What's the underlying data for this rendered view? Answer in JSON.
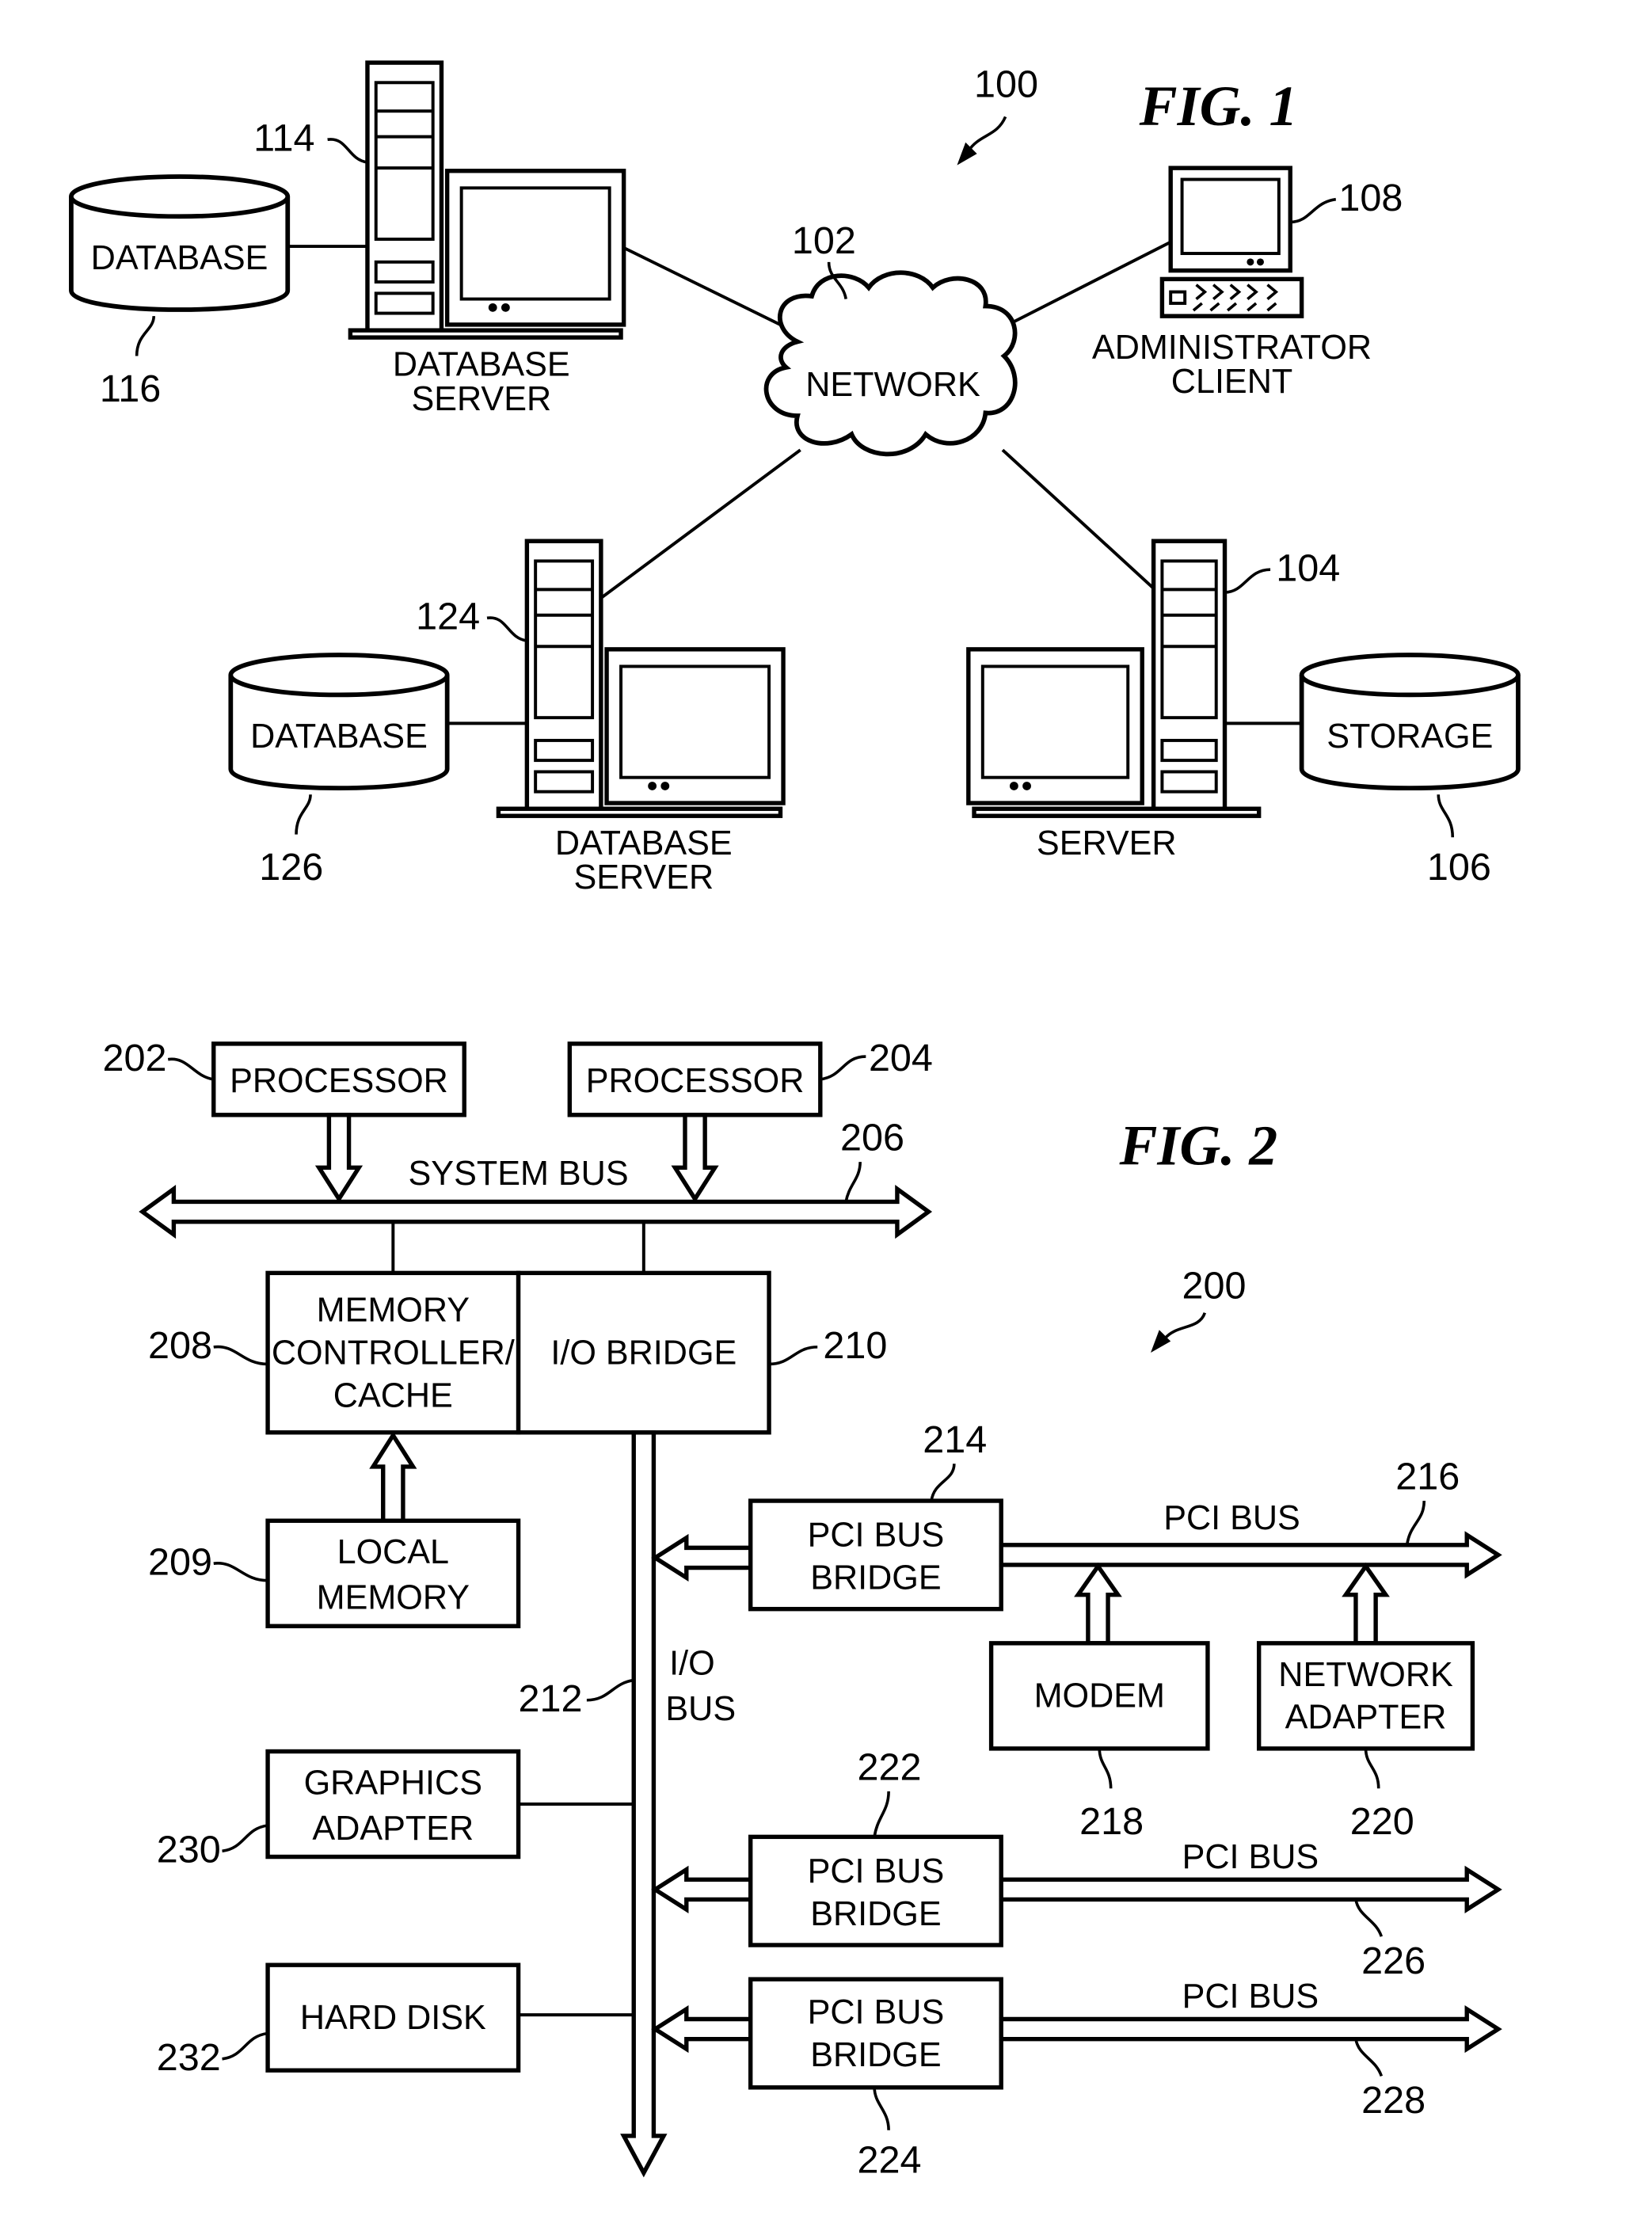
{
  "fig1": {
    "title": "FIG. 1",
    "system_ref": "100",
    "network": {
      "label": "NETWORK",
      "ref": "102"
    },
    "db_server_top": {
      "label_line1": "DATABASE",
      "label_line2": "SERVER",
      "ref": "114"
    },
    "database_top": {
      "label": "DATABASE",
      "ref": "116"
    },
    "admin_client": {
      "label_line1": "ADMINISTRATOR",
      "label_line2": "CLIENT",
      "ref": "108"
    },
    "db_server_bottom": {
      "label_line1": "DATABASE",
      "label_line2": "SERVER",
      "ref": "124"
    },
    "database_bottom": {
      "label": "DATABASE",
      "ref": "126"
    },
    "server": {
      "label": "SERVER",
      "ref": "104"
    },
    "storage": {
      "label": "STORAGE",
      "ref": "106"
    }
  },
  "fig2": {
    "title": "FIG. 2",
    "system_ref": "200",
    "processor_1": {
      "label": "PROCESSOR",
      "ref": "202"
    },
    "processor_2": {
      "label": "PROCESSOR",
      "ref": "204"
    },
    "system_bus": {
      "label": "SYSTEM BUS",
      "ref": "206"
    },
    "memory_controller": {
      "line1": "MEMORY",
      "line2": "CONTROLLER/",
      "line3": "CACHE",
      "ref": "208"
    },
    "io_bridge": {
      "label": "I/O BRIDGE",
      "ref": "210"
    },
    "local_memory": {
      "line1": "LOCAL",
      "line2": "MEMORY",
      "ref": "209"
    },
    "io_bus": {
      "line1": "I/O",
      "line2": "BUS",
      "ref": "212"
    },
    "pci_bridge_1": {
      "line1": "PCI BUS",
      "line2": "BRIDGE",
      "ref": "214"
    },
    "pci_bus_1": {
      "label": "PCI BUS",
      "ref": "216"
    },
    "modem": {
      "label": "MODEM",
      "ref": "218"
    },
    "network_adapter": {
      "line1": "NETWORK",
      "line2": "ADAPTER",
      "ref": "220"
    },
    "pci_bridge_2": {
      "line1": "PCI BUS",
      "line2": "BRIDGE",
      "ref": "222"
    },
    "pci_bus_2": {
      "label": "PCI BUS",
      "ref": "226"
    },
    "pci_bridge_3": {
      "line1": "PCI BUS",
      "line2": "BRIDGE",
      "ref": "224"
    },
    "pci_bus_3": {
      "label": "PCI BUS",
      "ref": "228"
    },
    "graphics_adapter": {
      "line1": "GRAPHICS",
      "line2": "ADAPTER",
      "ref": "230"
    },
    "hard_disk": {
      "label": "HARD DISK",
      "ref": "232"
    }
  }
}
